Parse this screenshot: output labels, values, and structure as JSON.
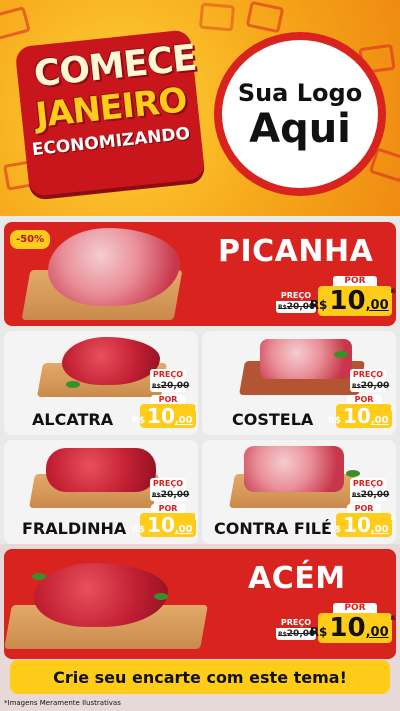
{
  "header": {
    "headline_line1": "COMECE",
    "headline_line2": "JANEIRO",
    "headline_line3": "ECONOMIZANDO",
    "logo_line1": "Sua Logo",
    "logo_line2": "Aqui",
    "background_color": "#f6a81a",
    "accent_color": "#d9231f"
  },
  "products": [
    {
      "name": "PICANHA",
      "discount": "-50%",
      "old_label": "PREÇO",
      "old_currency": "R$",
      "old_value": "20,00",
      "new_label": "POR",
      "currency": "R$",
      "new_int": "10",
      "new_dec": ",00",
      "unit": "KG"
    },
    {
      "name": "ALCATRA",
      "old_label": "PREÇO",
      "old_currency": "R$",
      "old_value": "20,00",
      "new_label": "POR",
      "currency": "R$",
      "new_int": "10",
      "new_dec": ",00",
      "unit": "KG"
    },
    {
      "name": "COSTELA",
      "old_label": "PREÇO",
      "old_currency": "R$",
      "old_value": "20,00",
      "new_label": "POR",
      "currency": "R$",
      "new_int": "10",
      "new_dec": ",00",
      "unit": "KG"
    },
    {
      "name": "FRALDINHA",
      "old_label": "PREÇO",
      "old_currency": "R$",
      "old_value": "20,00",
      "new_label": "POR",
      "currency": "R$",
      "new_int": "10",
      "new_dec": ",00",
      "unit": "KG"
    },
    {
      "name": "CONTRA FILÉ",
      "old_label": "PREÇO",
      "old_currency": "R$",
      "old_value": "20,00",
      "new_label": "POR",
      "currency": "R$",
      "new_int": "10",
      "new_dec": ",00",
      "unit": "KG"
    },
    {
      "name": "ACÉM",
      "old_label": "PREÇO",
      "old_currency": "R$",
      "old_value": "20,00",
      "new_label": "POR",
      "currency": "R$",
      "new_int": "10",
      "new_dec": ",00",
      "unit": "KG"
    }
  ],
  "footer": {
    "cta": "Crie seu encarte com este tema!",
    "disclaimer": "*Imagens Meramente Ilustrativas"
  },
  "colors": {
    "red": "#d9231f",
    "yellow": "#ffcc1a",
    "card_grey": "#f4f4f4"
  },
  "icons": [
    "shopping-cart-icon"
  ]
}
